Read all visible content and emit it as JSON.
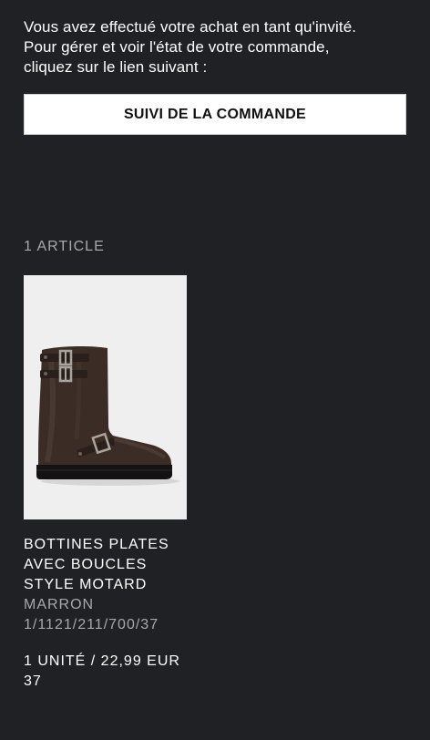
{
  "message": {
    "lines": [
      "Vous avez effectué votre achat en tant qu'invité.",
      "Pour gérer et voir l'état de votre commande,",
      "cliquez sur le lien suivant :"
    ]
  },
  "order_tracking_button": {
    "label": "SUIVI DE LA COMMANDE"
  },
  "items_count": "1 ARTICLE",
  "product": {
    "name_lines": [
      "BOTTINES PLATES",
      "AVEC BOUCLES",
      "STYLE MOTARD"
    ],
    "color": "MARRON",
    "reference": "1/1121/211/700/37",
    "quantity_price": "1 UNITÉ / 22,99 EUR",
    "size": "37",
    "image_icon": "boot-image"
  },
  "colors": {
    "background": "#202125",
    "button_bg": "#ffffff",
    "muted_text": "#a7a8ab"
  }
}
